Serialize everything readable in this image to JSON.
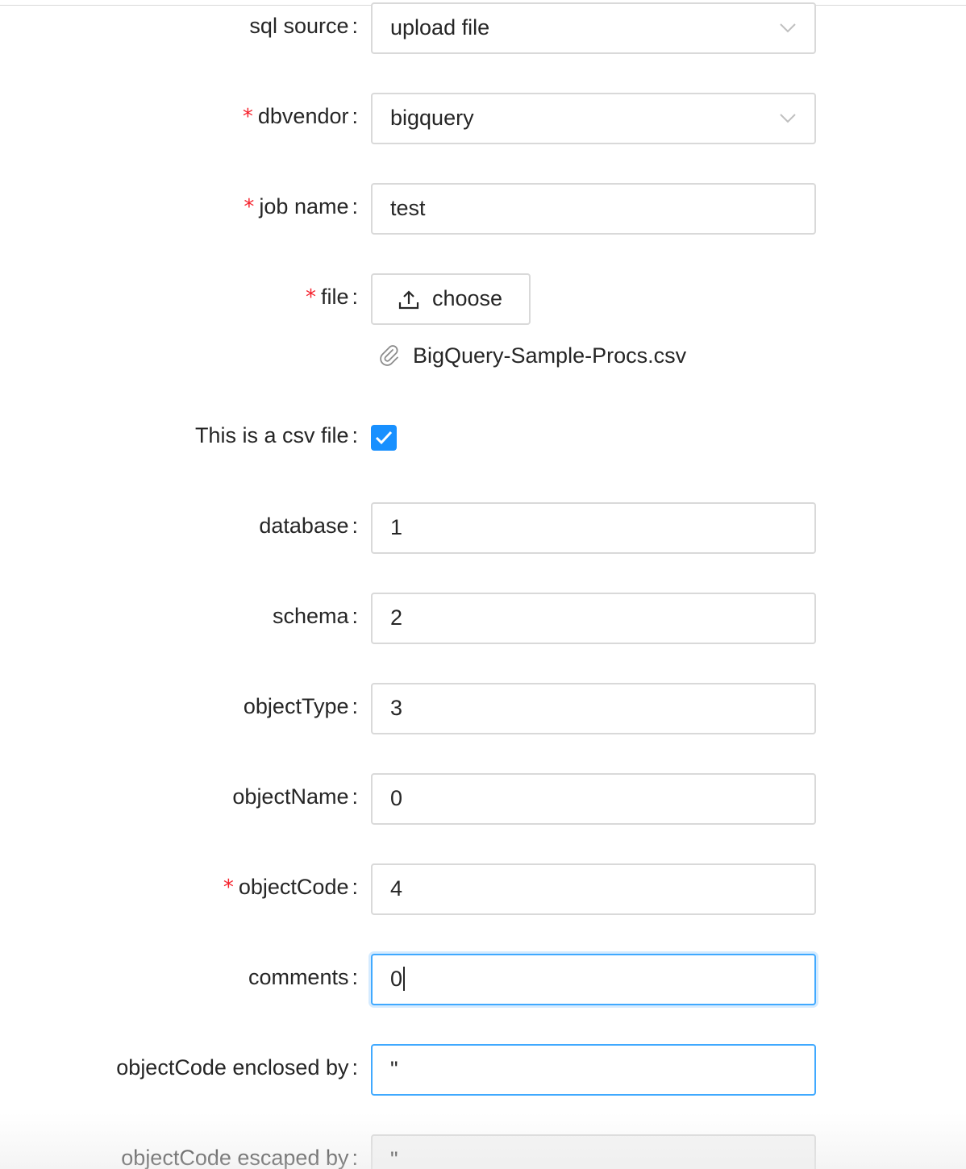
{
  "form": {
    "sql_source": {
      "label": "sql source",
      "value": "upload file",
      "required": false
    },
    "dbvendor": {
      "label": "dbvendor",
      "value": "bigquery",
      "required": true
    },
    "job_name": {
      "label": "job name",
      "value": "test",
      "required": true
    },
    "file": {
      "label": "file",
      "button_label": "choose",
      "uploaded_file": "BigQuery-Sample-Procs.csv",
      "required": true
    },
    "csv_flag": {
      "label": "This is a csv file",
      "checked": true
    },
    "database": {
      "label": "database",
      "value": "1"
    },
    "schema": {
      "label": "schema",
      "value": "2"
    },
    "object_type": {
      "label": "objectType",
      "value": "3"
    },
    "object_name": {
      "label": "objectName",
      "value": "0"
    },
    "object_code": {
      "label": "objectCode",
      "value": "4",
      "required": true
    },
    "comments": {
      "label": "comments",
      "value": "0"
    },
    "enclosed_by": {
      "label": "objectCode enclosed by",
      "value": "\""
    },
    "escaped_by": {
      "label": "objectCode escaped by",
      "value": "\""
    }
  },
  "colon": ":",
  "required_mark": "*",
  "colors": {
    "required": "#f5222d",
    "accent": "#1890ff",
    "focus_border": "#40a9ff",
    "border": "#d9d9d9"
  },
  "icons": {
    "select_arrow": "chevron-down-icon",
    "upload": "upload-icon",
    "attachment": "paperclip-icon",
    "checkbox": "check-icon"
  }
}
